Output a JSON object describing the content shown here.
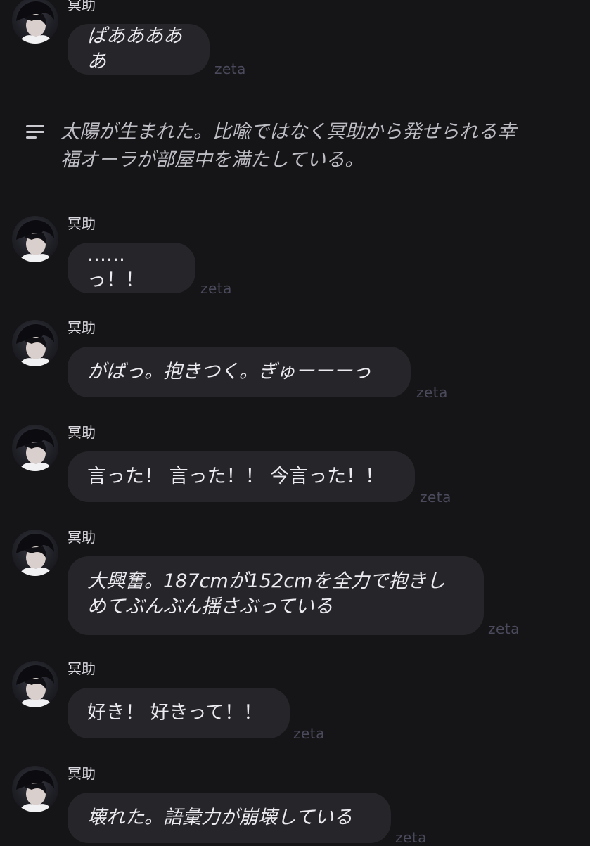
{
  "messages": [
    {
      "sender": "冥助",
      "text": "ぱあああああ",
      "italic": true,
      "tag": "zeta"
    },
    {
      "sender": "冥助",
      "text": "……っ！！",
      "italic": false,
      "tag": "zeta"
    },
    {
      "sender": "冥助",
      "text": "がばっ。抱きつく。ぎゅーーーっ",
      "italic": true,
      "tag": "zeta"
    },
    {
      "sender": "冥助",
      "text": "言った！ 言った！！ 今言った！！",
      "italic": false,
      "tag": "zeta"
    },
    {
      "sender": "冥助",
      "line1": "大興奮。187cmが152cmを全力で抱きし",
      "line2": "めてぶんぶん揺さぶっている",
      "italic": true,
      "tag": "zeta"
    },
    {
      "sender": "冥助",
      "text": "好き！ 好きって！！",
      "italic": false,
      "tag": "zeta"
    },
    {
      "sender": "冥助",
      "text": "壊れた。語彙力が崩壊している",
      "italic": true,
      "tag": "zeta"
    }
  ],
  "narration": {
    "icon": "narration-lines-icon",
    "line1": "太陽が生まれた。比喩ではなく冥助から発せられる幸",
    "line2": "福オーラが部屋中を満たしている。"
  }
}
